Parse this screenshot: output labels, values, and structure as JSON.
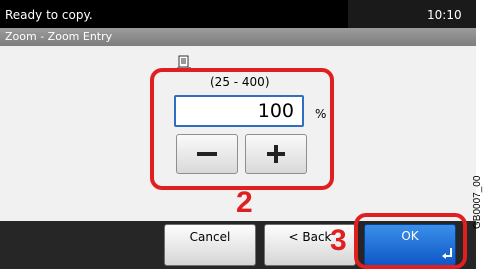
{
  "status": {
    "message": "Ready to copy.",
    "time": "10:10"
  },
  "title": "Zoom - Zoom Entry",
  "zoom": {
    "range_label": "(25 - 400)",
    "value": "100",
    "unit": "%",
    "minus_label": "−",
    "plus_label": "+"
  },
  "buttons": {
    "cancel": "Cancel",
    "back": "< Back",
    "ok": "OK"
  },
  "callouts": {
    "step_2": "2",
    "step_3": "3"
  },
  "figure_code": "GB0007_00",
  "colors": {
    "highlight": "#e02020",
    "ok_button": "#1a6fd8",
    "field_border": "#2f6fc2"
  },
  "icons": {
    "document": "document-icon",
    "enter": "enter-arrow-icon"
  }
}
